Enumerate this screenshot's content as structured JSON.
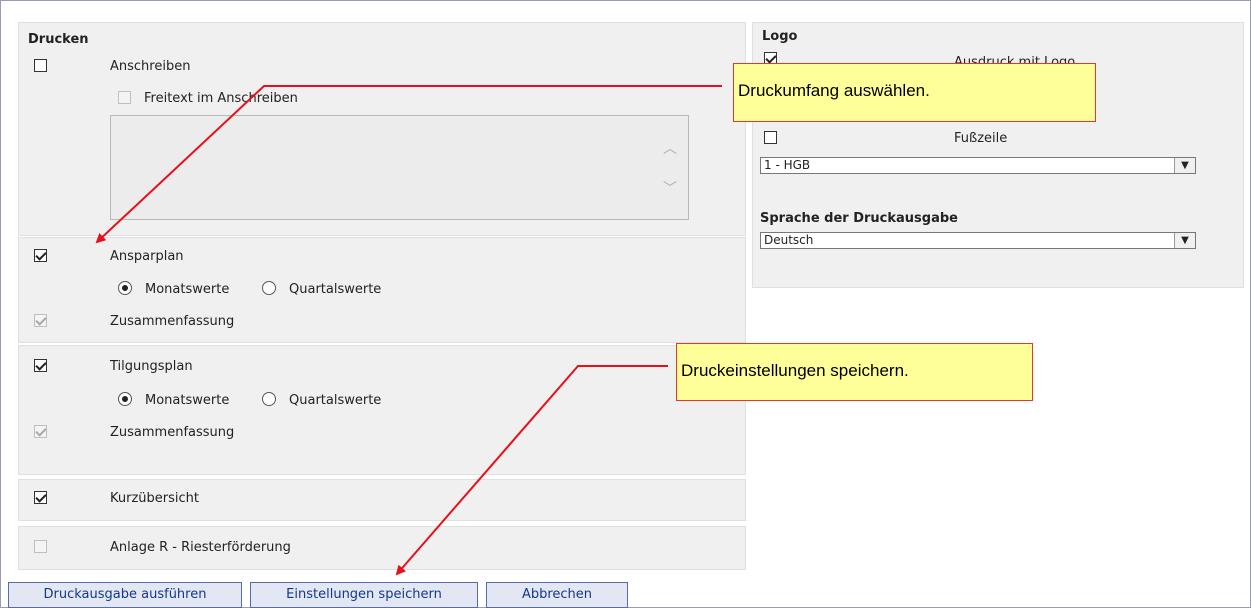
{
  "drucken": {
    "heading": "Drucken",
    "anschreiben": "Anschreiben",
    "freitext": "Freitext im Anschreiben",
    "ansparplan": "Ansparplan",
    "tilgungsplan": "Tilgungsplan",
    "monatswerte": "Monatswerte",
    "quartalswerte": "Quartalswerte",
    "zusammenfassung": "Zusammenfassung",
    "kurzuebersicht": "Kurzübersicht",
    "anlage_r": "Anlage R - Riesterförderung"
  },
  "logo": {
    "heading": "Logo",
    "ausdruck_mit_logo": "Ausdruck mit Logo",
    "fusszeile": "Fußzeile",
    "fusszeile_select": "1 - HGB",
    "sprache_heading": "Sprache der Druckausgabe",
    "sprache_select": "Deutsch"
  },
  "buttons": {
    "druckausgabe": "Druckausgabe ausführen",
    "einstellungen": "Einstellungen speichern",
    "abbrechen": "Abbrechen"
  },
  "callouts": {
    "druckumfang": "Druckumfang auswählen.",
    "speichern": "Druckeinstellungen speichern."
  },
  "colors": {
    "callout_fill": "#ffff99",
    "callout_border": "#e0372e",
    "arrow": "#e8101a",
    "button_text": "#123a8a"
  }
}
